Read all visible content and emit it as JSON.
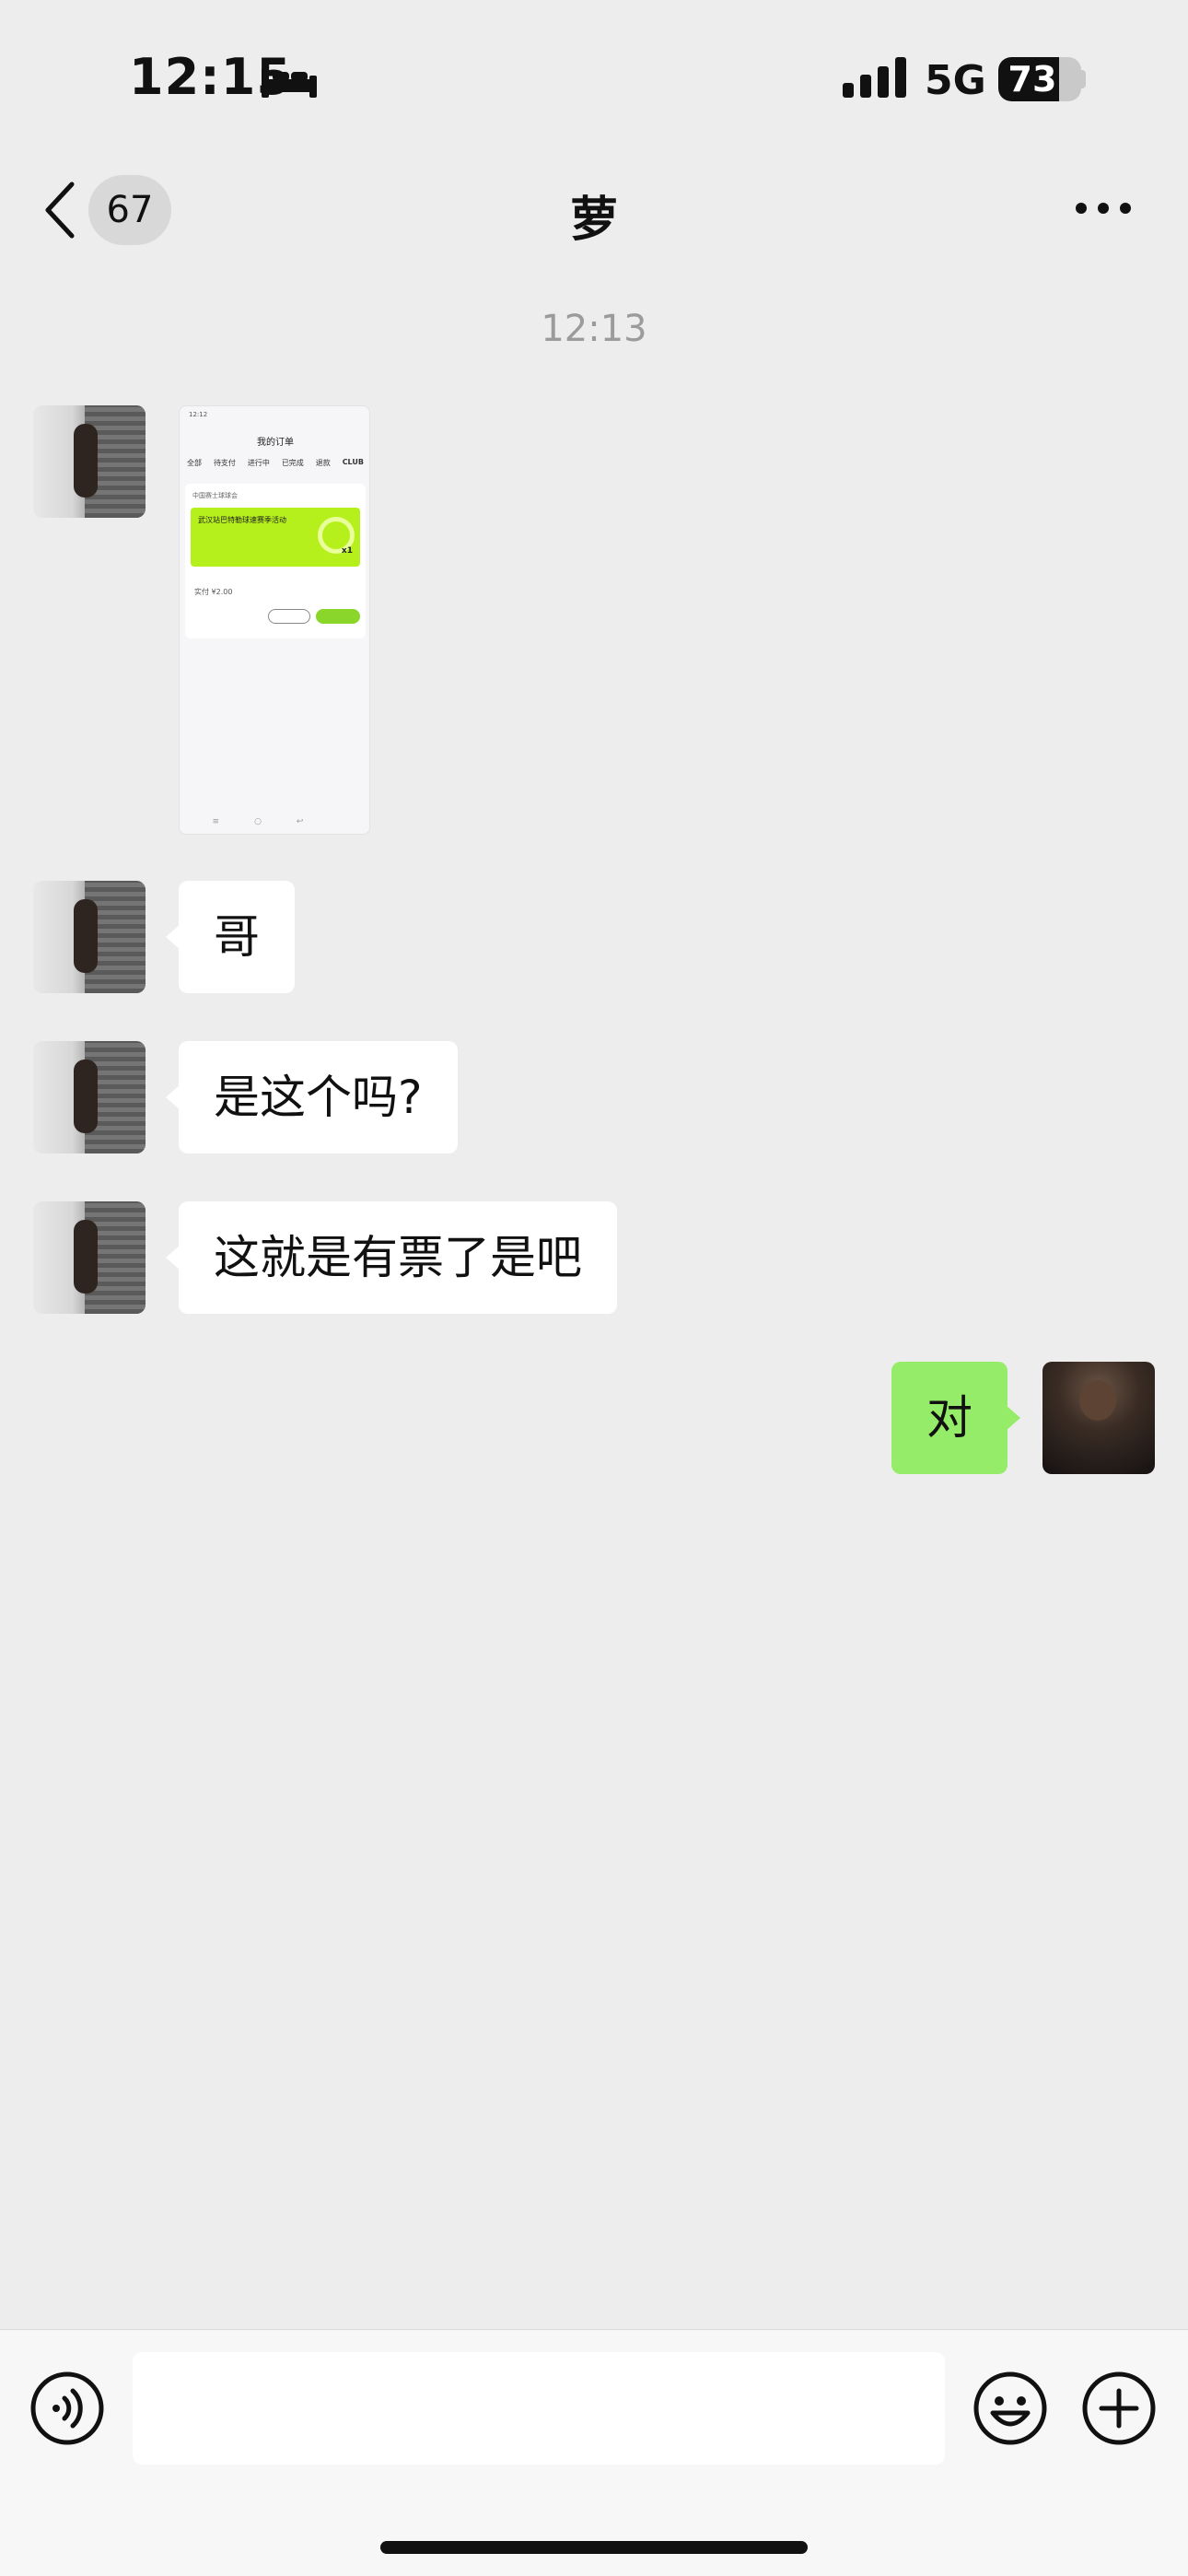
{
  "status_bar": {
    "time": "12:15",
    "network": "5G",
    "battery_level": 73,
    "battery_label": "73",
    "icons": [
      "sleep-bed-icon",
      "cellular-signal-icon",
      "battery-icon"
    ]
  },
  "nav": {
    "unread_count": "67",
    "title": "萝",
    "icons": [
      "chevron-left-icon",
      "more-dots-icon"
    ]
  },
  "timestamp": "12:13",
  "messages": [
    {
      "from": "peer",
      "type": "image",
      "thumbnail": {
        "status_time": "12:12",
        "nav_title": "我的订单",
        "tabs": [
          "全部",
          "待支付",
          "进行中",
          "已完成",
          "退款",
          "CLUB"
        ],
        "org": "中国赛士球球会",
        "banner_title": "武汉站巴特勒球速赛季活动",
        "quantity": "x1",
        "price": "实付 ¥2.00"
      }
    },
    {
      "from": "peer",
      "type": "text",
      "text": "哥"
    },
    {
      "from": "peer",
      "type": "text",
      "text": "是这个吗?"
    },
    {
      "from": "peer",
      "type": "text",
      "text": "这就是有票了是吧"
    },
    {
      "from": "self",
      "type": "text",
      "text": "对"
    }
  ],
  "input_bar": {
    "input_value": "",
    "icons": [
      "voice-icon",
      "emoji-icon",
      "plus-icon"
    ]
  },
  "colors": {
    "background": "#ededed",
    "self_bubble": "#95ec69",
    "peer_bubble": "#ffffff",
    "timestamp": "#9b9b9b"
  }
}
